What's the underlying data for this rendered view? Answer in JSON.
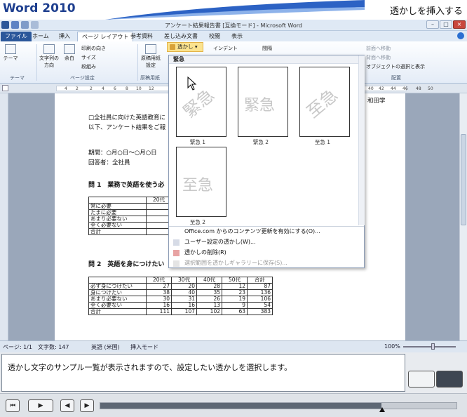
{
  "tutorial": {
    "product": "Word 2010",
    "step_title": "透かしを挿入する"
  },
  "window": {
    "title": "アンケート結果報告書 [互換モード] - Microsoft Word"
  },
  "tabs": [
    "ファイル",
    "ホーム",
    "挿入",
    "ページ レイアウト",
    "参考資料",
    "差し込み文書",
    "校閲",
    "表示"
  ],
  "ribbon": {
    "theme": "テーマ",
    "themes_group": "テーマ",
    "text_direction": "文字列の方向",
    "margins": "余白",
    "orientation": "印刷の向き",
    "size": "サイズ",
    "columns": "段組み",
    "page_setup_group": "ページ設定",
    "genkou": "原稿用紙設定",
    "genkou_group": "原稿用紙",
    "watermark": "透かし",
    "indent": "インデント",
    "spacing": "間隔",
    "front": "前面へ移動",
    "back": "背面へ移動",
    "selection_pane": "オブジェクトの選択と表示",
    "arrange_group": "配置"
  },
  "ruler_ticks": [
    "4",
    "2",
    "2",
    "4",
    "6",
    "8",
    "10",
    "12",
    "40",
    "42",
    "44",
    "46",
    "48",
    "50"
  ],
  "document": {
    "line1": "□全社員に向けた英語教育に",
    "line2": "以下、アンケート結果をご報",
    "right_fragment": "和田学",
    "period": "期間：○月○日～○月○日",
    "respondents": "回答者：全社員",
    "q1": "問 1　業務で英語を使う必",
    "q2": "問 2　英語を身につけたい",
    "table1": {
      "header": [
        "",
        "20代"
      ],
      "rows": [
        [
          "常に必要"
        ],
        [
          "たまに必要"
        ],
        [
          "あまり必要ない"
        ],
        [
          "全く必要ない"
        ],
        [
          "合計"
        ]
      ]
    },
    "table2": {
      "header": [
        "",
        "20代",
        "30代",
        "40代",
        "50代",
        "合計"
      ],
      "rows": [
        [
          "必ず身につけたい",
          "27",
          "20",
          "28",
          "12",
          "87"
        ],
        [
          "身につけたい",
          "38",
          "40",
          "35",
          "23",
          "136"
        ],
        [
          "あまり必要ない",
          "30",
          "31",
          "26",
          "19",
          "106"
        ],
        [
          "全く必要ない",
          "16",
          "16",
          "13",
          "9",
          "54"
        ],
        [
          "合計",
          "111",
          "107",
          "102",
          "63",
          "383"
        ]
      ]
    }
  },
  "dropdown": {
    "section": "緊急",
    "items": [
      {
        "caption": "緊急 1",
        "text": "緊急"
      },
      {
        "caption": "緊急 2",
        "text": "緊急"
      },
      {
        "caption": "至急 1",
        "text": "至急"
      },
      {
        "caption": "至急 2",
        "text": "至急"
      }
    ],
    "menu": [
      "Office.com からのコンテンツ更新を有効にする(O)...",
      "ユーザー設定の透かし(W)...",
      "透かしの削除(R)",
      "選択範囲を透かしギャラリーに保存(S)..."
    ]
  },
  "status": {
    "page": "ページ: 1/1",
    "words": "文字数: 147",
    "lang": "英語 (米国)",
    "mode": "挿入モード",
    "zoom": "100%"
  },
  "instruction": "透かし文字のサンプル一覧が表示されますので、設定したい透かしを選択します。",
  "playback": {
    "progress": 0.79
  }
}
